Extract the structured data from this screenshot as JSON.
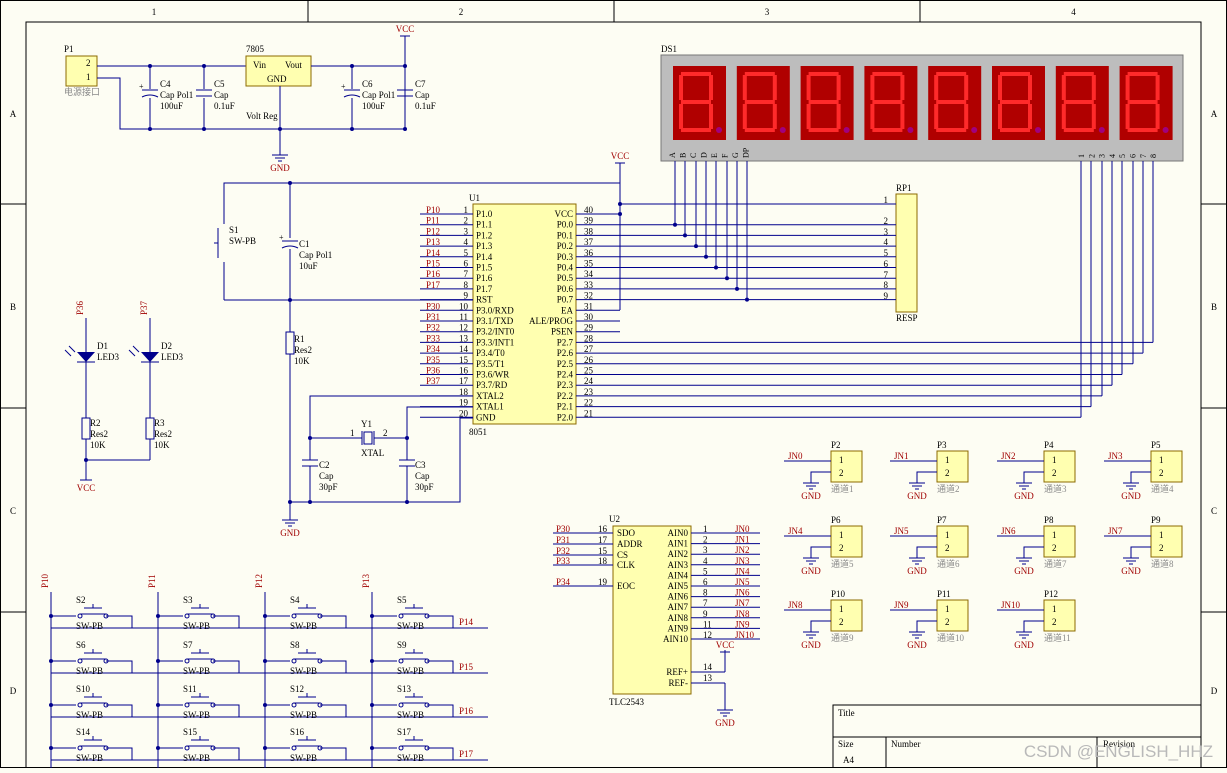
{
  "frame": {
    "columns": [
      "1",
      "2",
      "3",
      "4"
    ],
    "rows": [
      "A",
      "B",
      "C",
      "D"
    ]
  },
  "title_block": {
    "title_label": "Title",
    "size_label": "Size",
    "size_value": "A4",
    "number_label": "Number",
    "revision_label": "Revision"
  },
  "watermark": "CSDN @ENGLISH_HHZ",
  "power": {
    "connector_ref": "P1",
    "connector_name": "电源接口",
    "connector_pins": [
      "2",
      "1"
    ],
    "reg_ref": "7805",
    "reg_vin": "Vin",
    "reg_vout": "Vout",
    "reg_gnd": "GND",
    "reg_name": "Volt Reg",
    "vcc": "VCC",
    "gnd": "GND",
    "caps": [
      {
        "ref": "C4",
        "type": "Cap Pol1",
        "value": "100uF"
      },
      {
        "ref": "C5",
        "type": "Cap",
        "value": "0.1uF"
      },
      {
        "ref": "C6",
        "type": "Cap Pol1",
        "value": "100uF"
      },
      {
        "ref": "C7",
        "type": "Cap",
        "value": "0.1uF"
      }
    ]
  },
  "display": {
    "ref": "DS1",
    "digit_count": 8,
    "seg_labels": [
      "A",
      "B",
      "C",
      "D",
      "E",
      "F",
      "G",
      "DP"
    ],
    "com_labels": [
      "1",
      "2",
      "3",
      "4",
      "5",
      "6",
      "7",
      "8"
    ],
    "segment_color": "#d80000",
    "body_color": "#bdbdbd",
    "dp_color": "#a0007f"
  },
  "resnet": {
    "ref": "RP1",
    "name": "RESP",
    "pins": [
      "1",
      "2",
      "3",
      "4",
      "5",
      "6",
      "7",
      "8",
      "9"
    ]
  },
  "mcu": {
    "ref": "U1",
    "name": "8051",
    "vcc_label": "VCC",
    "left_pins": [
      {
        "num": "1",
        "name": "P1.0",
        "net": "P10"
      },
      {
        "num": "2",
        "name": "P1.1",
        "net": "P11"
      },
      {
        "num": "3",
        "name": "P1.2",
        "net": "P12"
      },
      {
        "num": "4",
        "name": "P1.3",
        "net": "P13"
      },
      {
        "num": "5",
        "name": "P1.4",
        "net": "P14"
      },
      {
        "num": "6",
        "name": "P1.5",
        "net": "P15"
      },
      {
        "num": "7",
        "name": "P1.6",
        "net": "P16"
      },
      {
        "num": "8",
        "name": "P1.7",
        "net": "P17"
      },
      {
        "num": "9",
        "name": "RST",
        "net": ""
      },
      {
        "num": "10",
        "name": "P3.0/RXD",
        "net": "P30"
      },
      {
        "num": "11",
        "name": "P3.1/TXD",
        "net": "P31"
      },
      {
        "num": "12",
        "name": "P3.2/INT0",
        "net": "P32"
      },
      {
        "num": "13",
        "name": "P3.3/INT1",
        "net": "P33"
      },
      {
        "num": "14",
        "name": "P3.4/T0",
        "net": "P34"
      },
      {
        "num": "15",
        "name": "P3.5/T1",
        "net": "P35"
      },
      {
        "num": "16",
        "name": "P3.6/WR",
        "net": "P36"
      },
      {
        "num": "17",
        "name": "P3.7/RD",
        "net": "P37"
      },
      {
        "num": "18",
        "name": "XTAL2",
        "net": ""
      },
      {
        "num": "19",
        "name": "XTAL1",
        "net": ""
      },
      {
        "num": "20",
        "name": "GND",
        "net": ""
      }
    ],
    "right_pins": [
      {
        "num": "40",
        "name": "VCC"
      },
      {
        "num": "39",
        "name": "P0.0"
      },
      {
        "num": "38",
        "name": "P0.1"
      },
      {
        "num": "37",
        "name": "P0.2"
      },
      {
        "num": "36",
        "name": "P0.3"
      },
      {
        "num": "35",
        "name": "P0.4"
      },
      {
        "num": "34",
        "name": "P0.5"
      },
      {
        "num": "33",
        "name": "P0.6"
      },
      {
        "num": "32",
        "name": "P0.7"
      },
      {
        "num": "31",
        "name": "EA"
      },
      {
        "num": "30",
        "name": "ALE/PROG"
      },
      {
        "num": "29",
        "name": "PSEN"
      },
      {
        "num": "28",
        "name": "P2.7"
      },
      {
        "num": "27",
        "name": "P2.6"
      },
      {
        "num": "26",
        "name": "P2.5"
      },
      {
        "num": "25",
        "name": "P2.4"
      },
      {
        "num": "24",
        "name": "P2.3"
      },
      {
        "num": "23",
        "name": "P2.2"
      },
      {
        "num": "22",
        "name": "P2.1"
      },
      {
        "num": "21",
        "name": "P2.0"
      }
    ]
  },
  "reset": {
    "switch_ref": "S1",
    "switch_type": "SW-PB",
    "cap_ref": "C1",
    "cap_type": "Cap Pol1",
    "cap_value": "10uF",
    "res_ref": "R1",
    "res_type": "Res2",
    "res_value": "10K",
    "gnd": "GND"
  },
  "crystal": {
    "ref": "Y1",
    "name": "XTAL",
    "pin1": "1",
    "pin2": "2",
    "c2_ref": "C2",
    "c2_type": "Cap",
    "c2_value": "30pF",
    "c3_ref": "C3",
    "c3_type": "Cap",
    "c3_value": "30pF"
  },
  "leds": [
    {
      "net": "P36",
      "ref": "D1",
      "type": "LED3",
      "r_ref": "R2",
      "r_type": "Res2",
      "r_value": "10K"
    },
    {
      "net": "P37",
      "ref": "D2",
      "type": "LED3",
      "r_ref": "R3",
      "r_type": "Res2",
      "r_value": "10K"
    }
  ],
  "led_vcc": "VCC",
  "keypad": {
    "col_nets": [
      "P10",
      "P11",
      "P12",
      "P13"
    ],
    "row_nets": [
      "P14",
      "P15",
      "P16",
      "P17"
    ],
    "switches": [
      [
        "S2",
        "S3",
        "S4",
        "S5"
      ],
      [
        "S6",
        "S7",
        "S8",
        "S9"
      ],
      [
        "S10",
        "S11",
        "S12",
        "S13"
      ],
      [
        "S14",
        "S15",
        "S16",
        "S17"
      ]
    ],
    "type": "SW-PB"
  },
  "adc": {
    "ref": "U2",
    "name": "TLC2543",
    "left_pins": [
      {
        "num": "16",
        "name": "SDO",
        "net": "P30"
      },
      {
        "num": "17",
        "name": "ADDR",
        "net": "P31"
      },
      {
        "num": "15",
        "name": "CS",
        "net": "P32"
      },
      {
        "num": "18",
        "name": "CLK",
        "net": "P33"
      },
      {
        "num": "19",
        "name": "EOC",
        "net": "P34"
      }
    ],
    "right_pins": [
      {
        "num": "1",
        "name": "AIN0",
        "net": "JN0"
      },
      {
        "num": "2",
        "name": "AIN1",
        "net": "JN1"
      },
      {
        "num": "3",
        "name": "AIN2",
        "net": "JN2"
      },
      {
        "num": "4",
        "name": "AIN3",
        "net": "JN3"
      },
      {
        "num": "5",
        "name": "AIN4",
        "net": "JN4"
      },
      {
        "num": "6",
        "name": "AIN5",
        "net": "JN5"
      },
      {
        "num": "8",
        "name": "AIN6",
        "net": "JN6"
      },
      {
        "num": "7",
        "name": "AIN7",
        "net": "JN7"
      },
      {
        "num": "9",
        "name": "AIN8",
        "net": "JN8"
      },
      {
        "num": "11",
        "name": "AIN9",
        "net": "JN9"
      },
      {
        "num": "12",
        "name": "AIN10",
        "net": "JN10"
      }
    ],
    "ref_plus": {
      "num": "14",
      "name": "REF+"
    },
    "ref_minus": {
      "num": "13",
      "name": "REF-"
    },
    "vcc": "VCC",
    "gnd": "GND"
  },
  "channels": [
    {
      "ref": "P2",
      "net": "JN0",
      "label": "通道1"
    },
    {
      "ref": "P3",
      "net": "JN1",
      "label": "通道2"
    },
    {
      "ref": "P4",
      "net": "JN2",
      "label": "通道3"
    },
    {
      "ref": "P5",
      "net": "JN3",
      "label": "通道4"
    },
    {
      "ref": "P6",
      "net": "JN4",
      "label": "通道5"
    },
    {
      "ref": "P7",
      "net": "JN5",
      "label": "通道6"
    },
    {
      "ref": "P8",
      "net": "JN6",
      "label": "通道7"
    },
    {
      "ref": "P9",
      "net": "JN7",
      "label": "通道8"
    },
    {
      "ref": "P10",
      "net": "JN8",
      "label": "通道9"
    },
    {
      "ref": "P11",
      "net": "JN9",
      "label": "通道10"
    },
    {
      "ref": "P12",
      "net": "JN10",
      "label": "通道11"
    }
  ],
  "channel_pins": [
    "1",
    "2"
  ],
  "gnd_label": "GND"
}
